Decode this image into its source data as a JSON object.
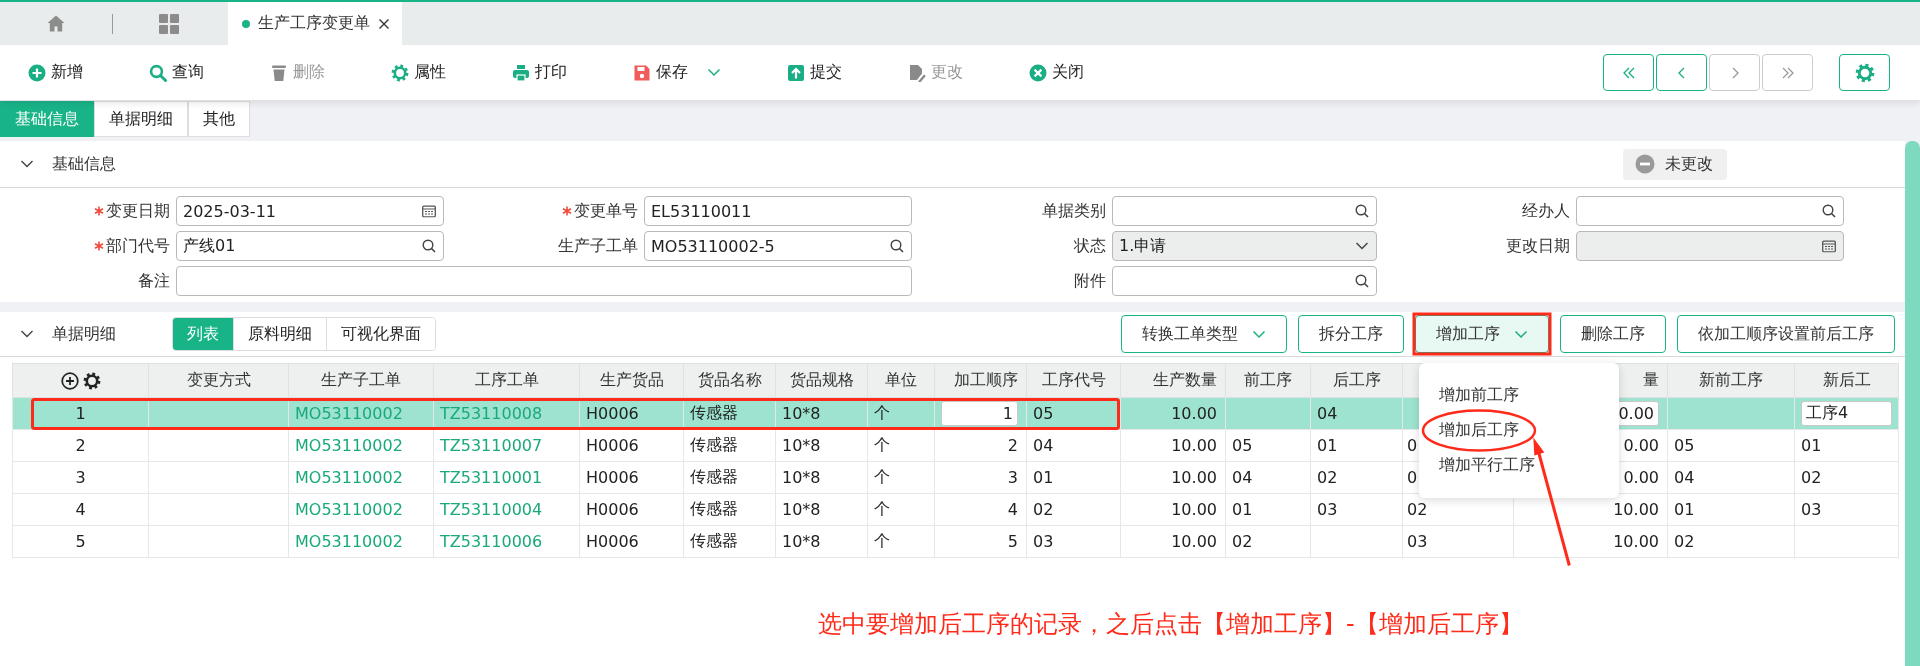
{
  "tabbar": {
    "tabs": [
      {
        "label": "生产工序变更单",
        "selected": true
      }
    ]
  },
  "toolbar": {
    "items": [
      {
        "label": "新增",
        "kind": "add",
        "disabled": false,
        "menu": false
      },
      {
        "label": "查询",
        "kind": "query",
        "disabled": false,
        "menu": false
      },
      {
        "label": "删除",
        "kind": "delete",
        "disabled": true,
        "menu": false
      },
      {
        "label": "属性",
        "kind": "props",
        "disabled": false,
        "menu": false
      },
      {
        "label": "打印",
        "kind": "print",
        "disabled": false,
        "menu": false
      },
      {
        "label": "保存",
        "kind": "save",
        "disabled": false,
        "menu": true
      },
      {
        "label": "提交",
        "kind": "submit",
        "disabled": false,
        "menu": false
      },
      {
        "label": "更改",
        "kind": "modify",
        "disabled": true,
        "menu": false
      },
      {
        "label": "关闭",
        "kind": "close",
        "disabled": false,
        "menu": false
      }
    ],
    "nav": [
      {
        "kind": "first",
        "disabled": false
      },
      {
        "kind": "prev",
        "disabled": false
      },
      {
        "kind": "next",
        "disabled": true
      },
      {
        "kind": "last",
        "disabled": true
      }
    ]
  },
  "page_tabs": [
    {
      "label": "基础信息",
      "selected": true
    },
    {
      "label": "单据明细",
      "selected": false
    },
    {
      "label": "其他",
      "selected": false
    }
  ],
  "basic_section": {
    "title": "基础信息",
    "expanded": true,
    "status": "未更改",
    "fields": [
      {
        "label": "变更日期",
        "required": true,
        "kind": "date",
        "value": "2025-03-11",
        "disabled": false
      },
      {
        "label": "变更单号",
        "required": true,
        "kind": "text",
        "value": "EL53110011",
        "disabled": false
      },
      {
        "label": "单据类别",
        "required": false,
        "kind": "search",
        "disabled": false
      },
      {
        "label": "经办人",
        "required": false,
        "kind": "search",
        "disabled": false
      },
      {
        "label": "部门代号",
        "required": true,
        "kind": "search",
        "value": "产线01",
        "disabled": false
      },
      {
        "label": "生产子工单",
        "required": false,
        "kind": "search",
        "value": "MO53110002-5",
        "disabled": false
      },
      {
        "label": "状态",
        "required": false,
        "kind": "select",
        "value": "1.申请",
        "disabled": true
      },
      {
        "label": "更改日期",
        "required": false,
        "kind": "date",
        "disabled": true
      },
      {
        "label": "备注",
        "required": false,
        "kind": "wide-text",
        "disabled": false
      },
      {
        "label": "附件",
        "required": false,
        "kind": "search",
        "disabled": false
      }
    ]
  },
  "detail_section": {
    "title": "单据明细",
    "expanded": true,
    "view_tabs": [
      {
        "label": "列表",
        "selected": true
      },
      {
        "label": "原料明细",
        "selected": false
      },
      {
        "label": "可视化界面",
        "selected": false
      }
    ],
    "actions": [
      {
        "label": "转换工单类型",
        "menu": true,
        "open": false,
        "framed": false
      },
      {
        "label": "拆分工序",
        "menu": false,
        "open": false,
        "framed": false
      },
      {
        "label": "增加工序",
        "menu": true,
        "open": true,
        "framed": true
      },
      {
        "label": "删除工序",
        "menu": false,
        "open": false,
        "framed": false
      },
      {
        "label": "依加工顺序设置前后工序",
        "menu": false,
        "open": false,
        "framed": false
      }
    ],
    "menu_items": [
      {
        "label": "增加前工序",
        "circled": false
      },
      {
        "label": "增加后工序",
        "circled": true
      },
      {
        "label": "增加平行工序",
        "circled": false
      }
    ],
    "table": {
      "columns": [
        {
          "kind": "index"
        },
        {
          "label": "变更方式",
          "kind": "text"
        },
        {
          "label": "生产子工单",
          "kind": "link"
        },
        {
          "label": "工序工单",
          "kind": "link"
        },
        {
          "label": "生产货品",
          "kind": "text"
        },
        {
          "label": "货品名称",
          "kind": "text"
        },
        {
          "label": "货品规格",
          "kind": "text"
        },
        {
          "label": "单位",
          "kind": "text"
        },
        {
          "label": "加工顺序",
          "kind": "number"
        },
        {
          "label": "工序代号",
          "kind": "text"
        },
        {
          "label": "生产数量",
          "kind": "number"
        },
        {
          "label": "前工序",
          "kind": "text"
        },
        {
          "label": "后工序",
          "kind": "text"
        },
        {
          "kind": "text"
        },
        {
          "label": "量",
          "kind": "number"
        },
        {
          "label": "新前工序",
          "kind": "text"
        },
        {
          "label": "新后工",
          "kind": "text"
        }
      ],
      "rows": [
        {
          "selected": true,
          "framed": true,
          "cells": [
            "1",
            null,
            "MO53110002",
            "TZ53110008",
            "H0006",
            "传感器",
            "10*8",
            "个",
            {
              "kind": "input",
              "value": "1"
            },
            "05",
            "10.00",
            null,
            "04",
            null,
            {
              "kind": "input",
              "value": "0.00"
            },
            null,
            {
              "kind": "input",
              "value": "工序4"
            }
          ]
        },
        {
          "selected": false,
          "framed": false,
          "cells": [
            "2",
            null,
            "MO53110002",
            "TZ53110007",
            "H0006",
            "传感器",
            "10*8",
            "个",
            "2",
            "04",
            "10.00",
            "05",
            "01",
            "0",
            "0.00",
            "05",
            "01"
          ]
        },
        {
          "selected": false,
          "framed": false,
          "cells": [
            "3",
            null,
            "MO53110002",
            "TZ53110001",
            "H0006",
            "传感器",
            "10*8",
            "个",
            "3",
            "01",
            "10.00",
            "04",
            "02",
            "0",
            "0.00",
            "04",
            "02"
          ]
        },
        {
          "selected": false,
          "framed": false,
          "cells": [
            "4",
            null,
            "MO53110002",
            "TZ53110004",
            "H0006",
            "传感器",
            "10*8",
            "个",
            "4",
            "02",
            "10.00",
            "01",
            "03",
            "02",
            "10.00",
            "01",
            "03"
          ]
        },
        {
          "selected": false,
          "framed": false,
          "cells": [
            "5",
            null,
            "MO53110002",
            "TZ53110006",
            "H0006",
            "传感器",
            "10*8",
            "个",
            "5",
            "03",
            "10.00",
            "02",
            null,
            "03",
            "10.00",
            "02",
            null
          ]
        }
      ]
    }
  },
  "annotation": "选中要增加后工序的记录，之后点击【增加工序】-【增加后工序】"
}
